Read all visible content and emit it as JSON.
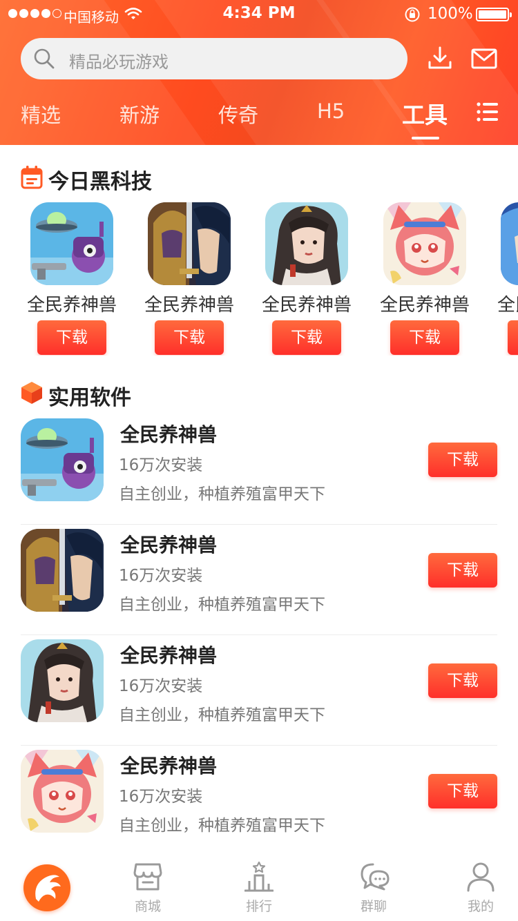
{
  "status_bar": {
    "carrier": "中国移动",
    "time": "4:34 PM",
    "battery": "100%"
  },
  "search": {
    "placeholder": "精品必玩游戏"
  },
  "icons": {
    "download": "download-icon",
    "mail": "mail-icon",
    "menu": "list-menu-icon",
    "search": "search-icon"
  },
  "tabs": [
    {
      "label": "精选",
      "active": false
    },
    {
      "label": "新游",
      "active": false
    },
    {
      "label": "传奇",
      "active": false
    },
    {
      "label": "H5",
      "active": false
    },
    {
      "label": "工具",
      "active": true
    }
  ],
  "sections": {
    "featured": {
      "title": "今日黑科技",
      "icon": "calendar-icon"
    },
    "software": {
      "title": "实用软件",
      "icon": "cube-icon"
    }
  },
  "featured_apps": [
    {
      "name": "全民养神兽",
      "button": "下载",
      "art": "ufo-robot"
    },
    {
      "name": "全民养神兽",
      "button": "下载",
      "art": "knight-sword"
    },
    {
      "name": "全民养神兽",
      "button": "下载",
      "art": "ancient-lady"
    },
    {
      "name": "全民养神兽",
      "button": "下载",
      "art": "fox-girl"
    },
    {
      "name": "全民养神兽",
      "button": "下载",
      "art": "blue-hero"
    }
  ],
  "software_list": [
    {
      "name": "全民养神兽",
      "installs": "16万次安装",
      "desc": "自主创业，种植养殖富甲天下",
      "button": "下载",
      "art": "ufo-robot"
    },
    {
      "name": "全民养神兽",
      "installs": "16万次安装",
      "desc": "自主创业，种植养殖富甲天下",
      "button": "下载",
      "art": "knight-sword"
    },
    {
      "name": "全民养神兽",
      "installs": "16万次安装",
      "desc": "自主创业，种植养殖富甲天下",
      "button": "下载",
      "art": "ancient-lady"
    },
    {
      "name": "全民养神兽",
      "installs": "16万次安装",
      "desc": "自主创业，种植养殖富甲天下",
      "button": "下载",
      "art": "fox-girl"
    }
  ],
  "tabbar": [
    {
      "label": "",
      "icon": "home-logo-icon"
    },
    {
      "label": "商城",
      "icon": "store-icon"
    },
    {
      "label": "排行",
      "icon": "ranking-icon"
    },
    {
      "label": "群聊",
      "icon": "chat-icon"
    },
    {
      "label": "我的",
      "icon": "profile-icon"
    }
  ],
  "colors": {
    "accent": "#ff4b1f",
    "button": "#ff3b2f",
    "home": "#ff6a1d"
  }
}
